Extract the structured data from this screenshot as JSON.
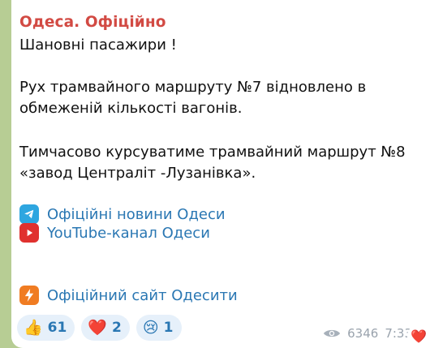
{
  "channel": {
    "name": "Одеса. Офіційно"
  },
  "message": {
    "greeting": "Шановні пасажири !",
    "p2_line1": "Рух трамвайного маршруту №7 відновлено в",
    "p2_line2": "обмеженій кількості вагонів.",
    "p3_line1": "Тимчасово курсуватиме трамвайний маршрут №8",
    "p3_line2": "«завод Централіт -Лузанівка».",
    "links": [
      {
        "label": "Офіційні новини Одеси",
        "icon": "telegram-icon"
      },
      {
        "label": "YouTube-канал Одеси",
        "icon": "youtube-icon"
      },
      {
        "label": "Офіційний сайт Одесити",
        "icon": "lightning-icon"
      }
    ]
  },
  "reactions": [
    {
      "emoji": "👍",
      "count": "61",
      "name": "thumbs-up-icon"
    },
    {
      "emoji": "❤️",
      "count": "2",
      "name": "heart-icon"
    },
    {
      "emoji": "😢",
      "count": "1",
      "name": "crying-face-icon"
    }
  ],
  "meta": {
    "views": "6346",
    "time": "7:33"
  },
  "corner_reaction": {
    "emoji": "❤️"
  }
}
